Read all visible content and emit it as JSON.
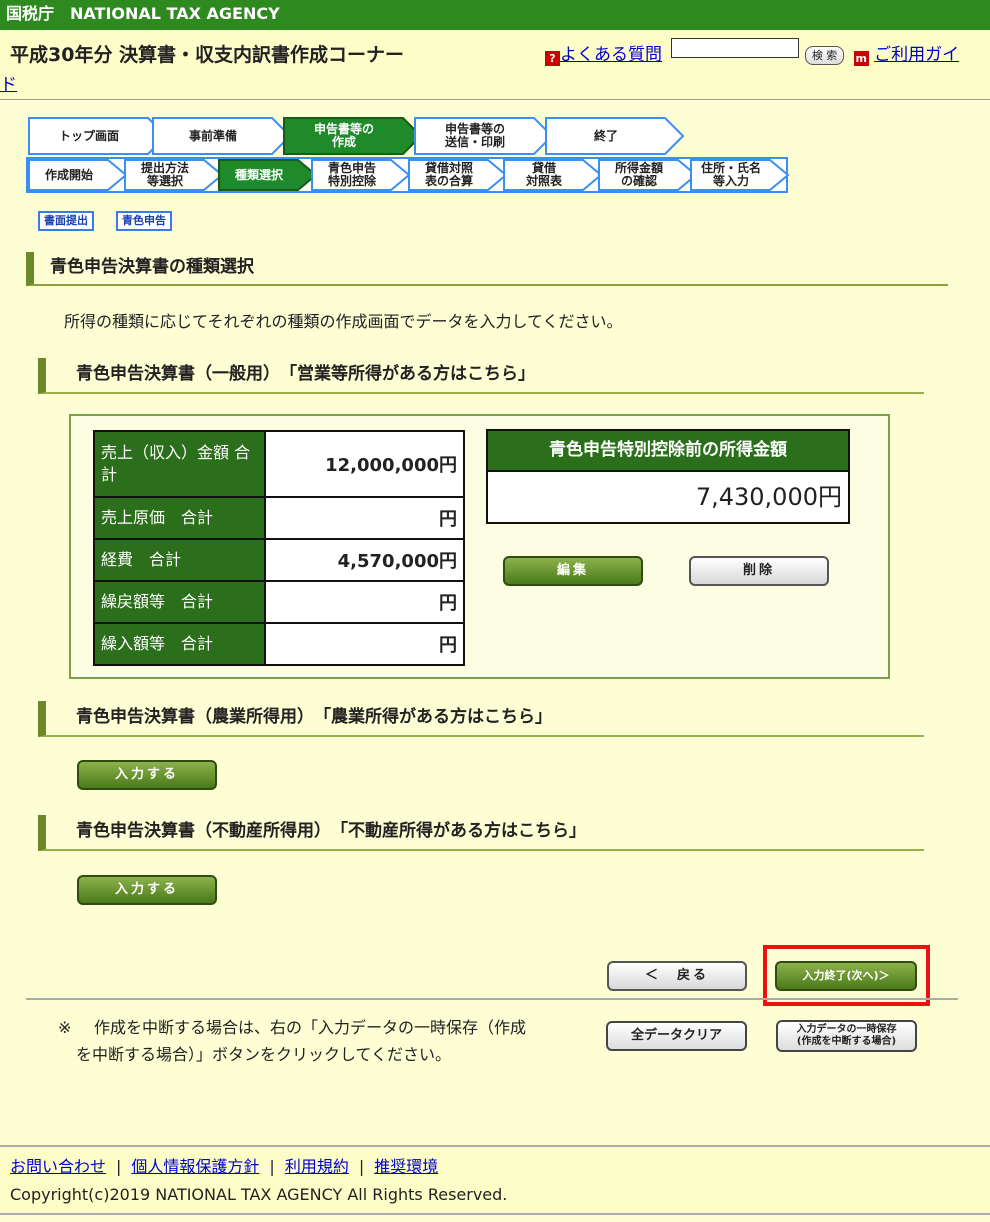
{
  "header": {
    "agency": "国税庁　NATIONAL TAX AGENCY",
    "title": "平成30年分 決算書・収支内訳書作成コーナー",
    "faq_icon": "?",
    "faq_link": "よくある質問",
    "search_button": "検 索",
    "guide_icon": "m",
    "guide_link": "ご利用ガイ",
    "guide_link_wrap": "ド"
  },
  "steps_main": [
    {
      "label": "トップ画面",
      "active": false
    },
    {
      "label": "事前準備",
      "active": false
    },
    {
      "label": "申告書等の\n作成",
      "active": true
    },
    {
      "label": "申告書等の\n送信・印刷",
      "active": false
    },
    {
      "label": "終了",
      "active": false
    }
  ],
  "steps_sub": [
    {
      "label": "作成開始",
      "active": false
    },
    {
      "label": "提出方法\n等選択",
      "active": false
    },
    {
      "label": "種類選択",
      "active": true
    },
    {
      "label": "青色申告\n特別控除",
      "active": false
    },
    {
      "label": "貸借対照\n表の合算",
      "active": false
    },
    {
      "label": "貸借\n対照表",
      "active": false
    },
    {
      "label": "所得金額\nの確認",
      "active": false
    },
    {
      "label": "住所・氏名\n等入力",
      "active": false
    }
  ],
  "tags": [
    "書面提出",
    "青色申告"
  ],
  "section_title": "青色申告決算書の種類選択",
  "intro": "所得の種類に応じてそれぞれの種類の作成画面でデータを入力してください。",
  "general": {
    "heading": "青色申告決算書（一般用）　「営業等所得がある方はこちら」",
    "rows": [
      {
        "label": "売上（収入）金額 合計",
        "value": "12,000,000円"
      },
      {
        "label": "売上原価　合計",
        "value": "円"
      },
      {
        "label": "経費　合計",
        "value": "4,570,000円"
      },
      {
        "label": "繰戻額等　合計",
        "value": "円"
      },
      {
        "label": "繰入額等　合計",
        "value": "円"
      }
    ],
    "income_header": "青色申告特別控除前の所得金額",
    "income_value": "7,430,000円",
    "edit_button": "編集",
    "delete_button": "削除"
  },
  "farm": {
    "heading": "青色申告決算書（農業所得用）　「農業所得がある方はこちら」",
    "input_button": "入力する"
  },
  "realestate": {
    "heading": "青色申告決算書（不動産所得用）　「不動産所得がある方はこちら」",
    "input_button": "入力する"
  },
  "nav": {
    "back_button": "＜　戻る",
    "next_button": "入力終了(次へ)＞"
  },
  "note": {
    "mark": "※",
    "text": "作成を中断する場合は、右の「入力データの一時保存（作成を中断する場合）」ボタンをクリックしてください。"
  },
  "clear_button": "全データクリア",
  "save_button_line1": "入力データの一時保存",
  "save_button_line2": "(作成を中断する場合)",
  "footer": {
    "links": [
      "お問い合わせ",
      "個人情報保護方針",
      "利用規約",
      "推奨環境"
    ],
    "separator": "|",
    "copyright": "Copyright(c)2019 NATIONAL TAX AGENCY All Rights Reserved."
  },
  "colors": {
    "topbar": "#2e8a1e",
    "page_bg": "#fefed4",
    "table_label_bg": "#2b6e1b",
    "active_step_top": "#1f8a2a",
    "active_step_sub": "#1e8a2a",
    "highlight": "#ee1111"
  }
}
